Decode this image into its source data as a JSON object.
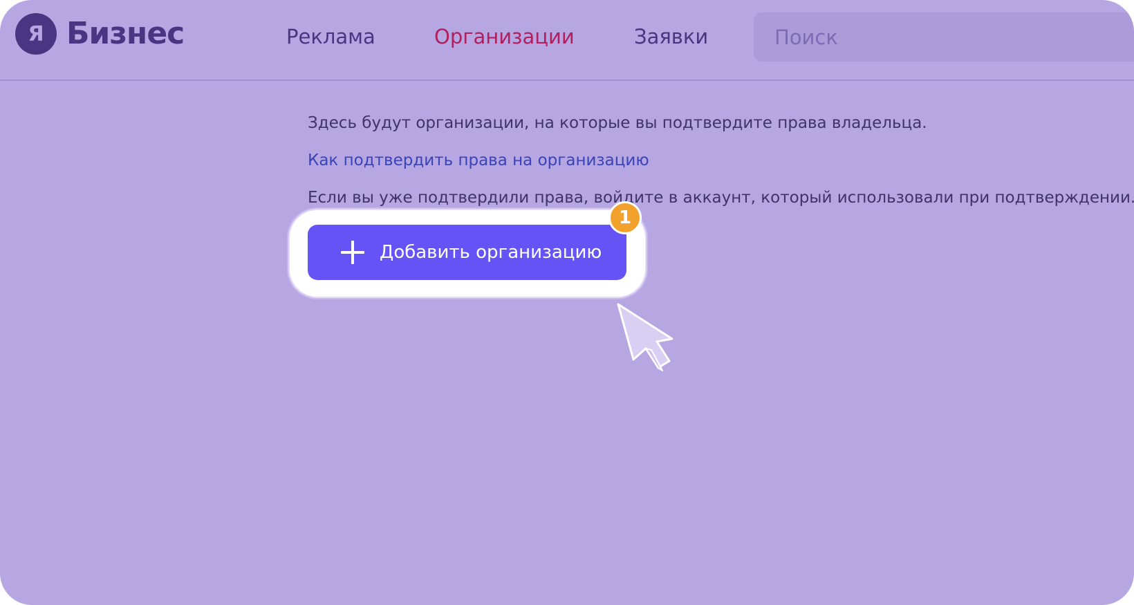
{
  "header": {
    "logo_mark": "Я",
    "logo_text": "Бизнес",
    "nav": [
      {
        "label": "Реклама"
      },
      {
        "label": "Организации"
      },
      {
        "label": "Заявки"
      }
    ],
    "search_placeholder": "Поиск"
  },
  "main": {
    "intro_text": "Здесь будут организации, на которые вы подтвердите права владельца.",
    "help_link": "Как подтвердить права на организацию",
    "hint_text": "Если вы уже подтвердили права, войдите в аккаунт, который использовали при подтверждении.",
    "add_button_label": "Добавить организацию",
    "step_badge": "1"
  },
  "colors": {
    "background": "#b6a6e2",
    "brand": "#4a3583",
    "active_nav": "#b21f5e",
    "link": "#3a43b8",
    "button": "#6553f6",
    "badge": "#f2a22c"
  },
  "icons": {
    "button_icon": "plus-icon",
    "pointer": "cursor-pointer-icon"
  }
}
